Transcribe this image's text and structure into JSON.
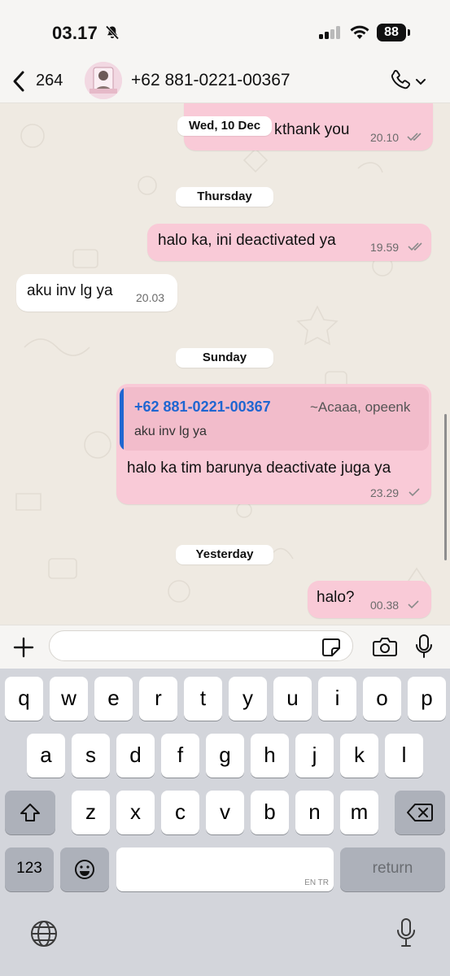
{
  "status_bar": {
    "time": "03.17",
    "battery": "88"
  },
  "header": {
    "back_count": "264",
    "contact_name": "+62 881-0221-00367"
  },
  "chat": {
    "messages": [
      {
        "id": "m1",
        "direction": "out",
        "text": "thank you",
        "hidden_prefix": "k",
        "time": "20.10",
        "status": "read"
      },
      {
        "id": "m2",
        "direction": "out",
        "text": "halo ka, ini deactivated ya",
        "time": "19.59",
        "status": "read"
      },
      {
        "id": "m3",
        "direction": "in",
        "text": "aku inv lg ya",
        "time": "20.03"
      },
      {
        "id": "m4",
        "direction": "out",
        "text": "halo ka tim barunya deactivate juga ya",
        "time": "23.29",
        "status": "sent",
        "reply": {
          "sender": "+62 881-0221-00367",
          "sender_alias": "~Acaaa, opeenk",
          "text": "aku inv lg ya"
        }
      },
      {
        "id": "m5",
        "direction": "out",
        "text": "halo?",
        "time": "00.38",
        "status": "sent"
      }
    ],
    "date_chips": [
      "Wed, 10 Dec",
      "Thursday",
      "Sunday",
      "Yesterday"
    ]
  },
  "composer": {
    "placeholder": ""
  },
  "keyboard": {
    "row1": [
      "q",
      "w",
      "e",
      "r",
      "t",
      "y",
      "u",
      "i",
      "o",
      "p"
    ],
    "row2": [
      "a",
      "s",
      "d",
      "f",
      "g",
      "h",
      "j",
      "k",
      "l"
    ],
    "row3": [
      "z",
      "x",
      "c",
      "v",
      "b",
      "n",
      "m"
    ],
    "numbers_key": "123",
    "return_key": "return",
    "space_hint": "EN TR"
  },
  "colors": {
    "outgoing_bubble": "#f9cad7",
    "incoming_bubble": "#ffffff",
    "chat_bg": "#efeae2",
    "reply_accent": "#1f66d1"
  },
  "icons": [
    "mute-icon",
    "signal-icon",
    "wifi-icon",
    "back-icon",
    "avatar",
    "phone-icon",
    "chevron-down-icon",
    "double-check-icon",
    "check-icon",
    "plus-icon",
    "sticker-icon",
    "camera-icon",
    "mic-icon",
    "shift-icon",
    "backspace-icon",
    "emoji-icon",
    "globe-icon",
    "dictation-mic-icon"
  ]
}
